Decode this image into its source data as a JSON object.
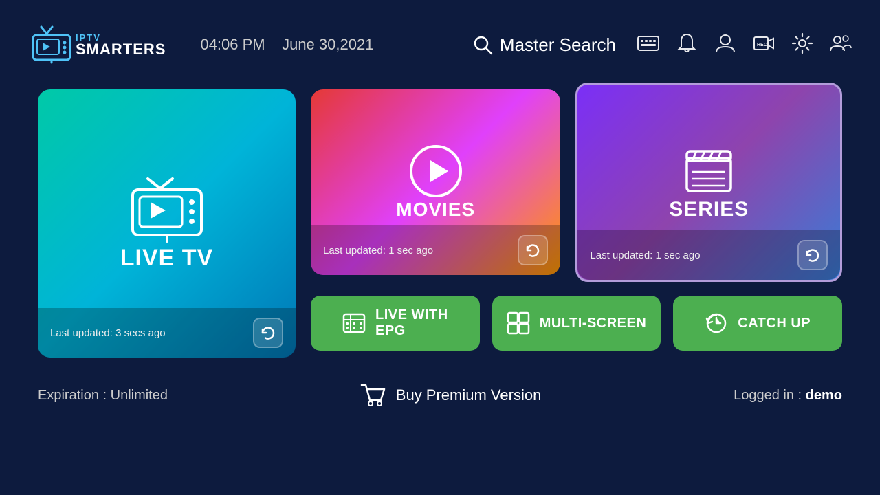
{
  "header": {
    "logo_iptv": "IPTV",
    "logo_smarters": "SMARTERS",
    "time": "04:06 PM",
    "date": "June 30,2021",
    "search_label": "Master Search"
  },
  "cards": {
    "live_tv": {
      "label": "LIVE TV",
      "last_updated": "Last updated: 3 secs ago"
    },
    "movies": {
      "label": "MOVIES",
      "last_updated": "Last updated: 1 sec ago"
    },
    "series": {
      "label": "SERIES",
      "last_updated": "Last updated: 1 sec ago"
    }
  },
  "buttons": {
    "live_epg": "LIVE WITH\nEPG",
    "live_epg_line1": "LIVE WITH",
    "live_epg_line2": "EPG",
    "multi_screen": "MULTI-SCREEN",
    "catch_up": "CATCH UP"
  },
  "footer": {
    "expiry_label": "Expiration :",
    "expiry_value": "Unlimited",
    "buy_premium": "Buy Premium Version",
    "logged_in_label": "Logged in :",
    "logged_in_user": "demo"
  }
}
